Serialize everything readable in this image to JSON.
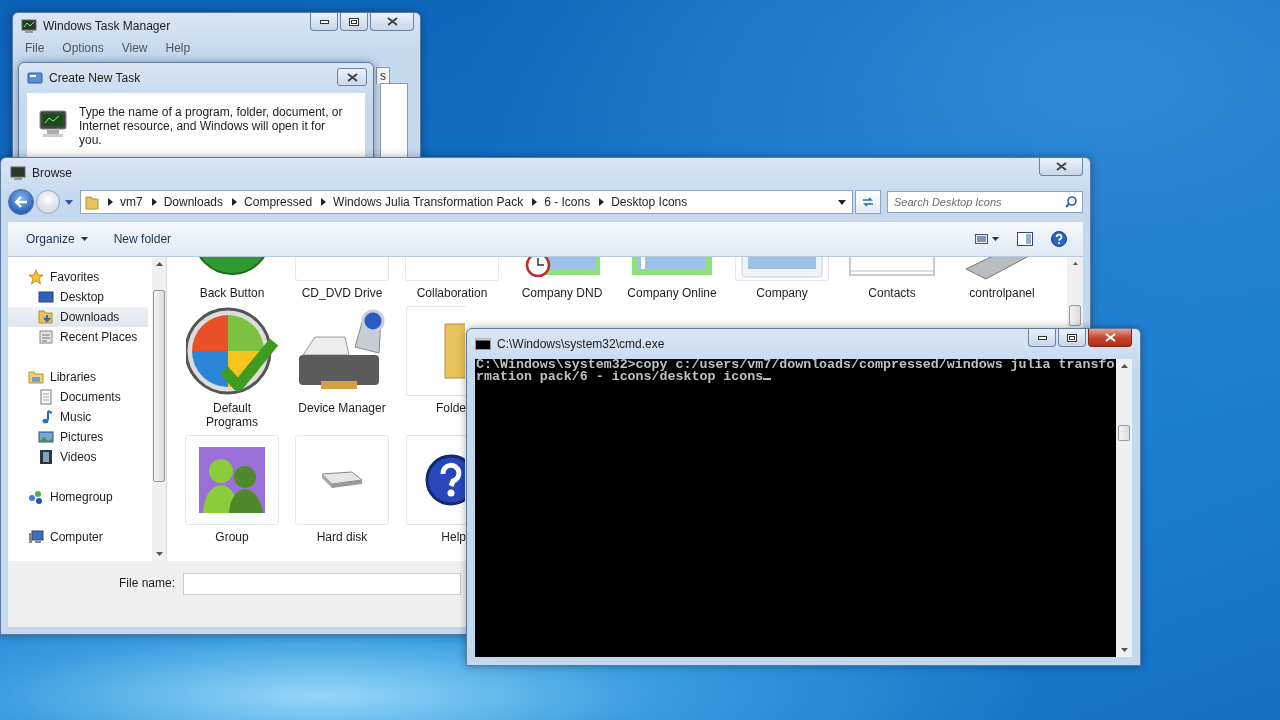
{
  "task_manager": {
    "title": "Windows Task Manager",
    "menu": [
      "File",
      "Options",
      "View",
      "Help"
    ],
    "tab_fragment": "s",
    "dialog": {
      "title": "Create New Task",
      "message": "Type the name of a program, folder, document, or Internet resource, and Windows will open it for you."
    }
  },
  "browse": {
    "title": "Browse",
    "breadcrumbs": [
      "vm7",
      "Downloads",
      "Compressed",
      "Windows Julia Transformation Pack",
      "6 - Icons",
      "Desktop Icons"
    ],
    "search": {
      "placeholder": "Search Desktop Icons"
    },
    "toolbar": {
      "organize": "Organize",
      "new_folder": "New folder"
    },
    "sidebar": {
      "items": [
        {
          "label": "Favorites",
          "kind": "star",
          "selected": false,
          "children": [
            {
              "label": "Desktop",
              "kind": "desktop",
              "selected": false
            },
            {
              "label": "Downloads",
              "kind": "downloads",
              "selected": true
            },
            {
              "label": "Recent Places",
              "kind": "recent",
              "selected": false
            }
          ]
        },
        {
          "label": "Libraries",
          "kind": "libraries",
          "selected": false,
          "children": [
            {
              "label": "Documents",
              "kind": "documents",
              "selected": false
            },
            {
              "label": "Music",
              "kind": "music",
              "selected": false
            },
            {
              "label": "Pictures",
              "kind": "pictures",
              "selected": false
            },
            {
              "label": "Videos",
              "kind": "videos",
              "selected": false
            }
          ]
        },
        {
          "label": "Homegroup",
          "kind": "homegroup",
          "selected": false
        },
        {
          "label": "Computer",
          "kind": "computer",
          "selected": false
        }
      ]
    },
    "icon_rows": [
      [
        {
          "label": "Back Button",
          "kind": "green-ball"
        },
        {
          "label": "CD_DVD Drive",
          "kind": "blank"
        },
        {
          "label": "Collaboration",
          "kind": "blank"
        },
        {
          "label": "Company DND",
          "kind": "clock-frame"
        },
        {
          "label": "Company Online",
          "kind": "green-frame"
        },
        {
          "label": "Company",
          "kind": "blue-frame"
        },
        {
          "label": "Contacts",
          "kind": "card"
        },
        {
          "label": "controlpanel",
          "kind": "remote"
        }
      ],
      [
        {
          "label": "Default Programs",
          "kind": "globe-check"
        },
        {
          "label": "Device Manager",
          "kind": "printer"
        },
        {
          "label": "Folde",
          "kind": "folder",
          "partial": true
        }
      ],
      [
        {
          "label": "Group",
          "kind": "people"
        },
        {
          "label": "Hard disk",
          "kind": "disk"
        },
        {
          "label": "Help",
          "kind": "help",
          "partial": true
        }
      ]
    ],
    "file_name_label": "File name:"
  },
  "cmd": {
    "title": "C:\\Windows\\system32\\cmd.exe",
    "lines": [
      "C:\\Windows\\system32>copy c:/users/vm7/downloads/compressed/windows julia transfo",
      "rmation pack/6 - icons/desktop icons"
    ]
  }
}
